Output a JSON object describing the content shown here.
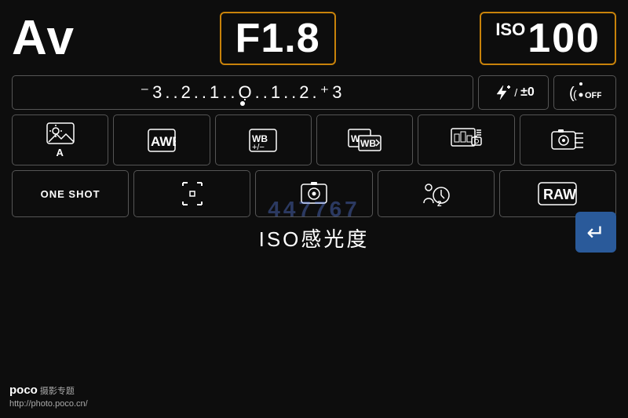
{
  "screen": {
    "background_color": "#0d0d0d",
    "watermark": "447767"
  },
  "top": {
    "mode_label": "Av",
    "aperture": "F1.8",
    "iso_label": "ISO",
    "iso_value": "100"
  },
  "exposure_row": {
    "scale": "⁻3..2..1..0..1..2.⁺3",
    "flash_label": "±0",
    "wifi_label": "OFF"
  },
  "row2": {
    "cell1_label": "A",
    "cell2_label": "AWB",
    "cell3_label": "WB\n+/−",
    "cell4_label": "WB",
    "cell5_label": "",
    "cell6_label": ""
  },
  "row3": {
    "cell1_label": "ONE SHOT",
    "cell2_label": "",
    "cell3_label": "",
    "cell4_label": "",
    "cell5_label": "RAW"
  },
  "bottom": {
    "iso_text": "ISO感光度",
    "back_label": "↵"
  },
  "poco": {
    "brand": "poco",
    "tagline": "摄影专题",
    "url": "http://photo.poco.cn/"
  }
}
